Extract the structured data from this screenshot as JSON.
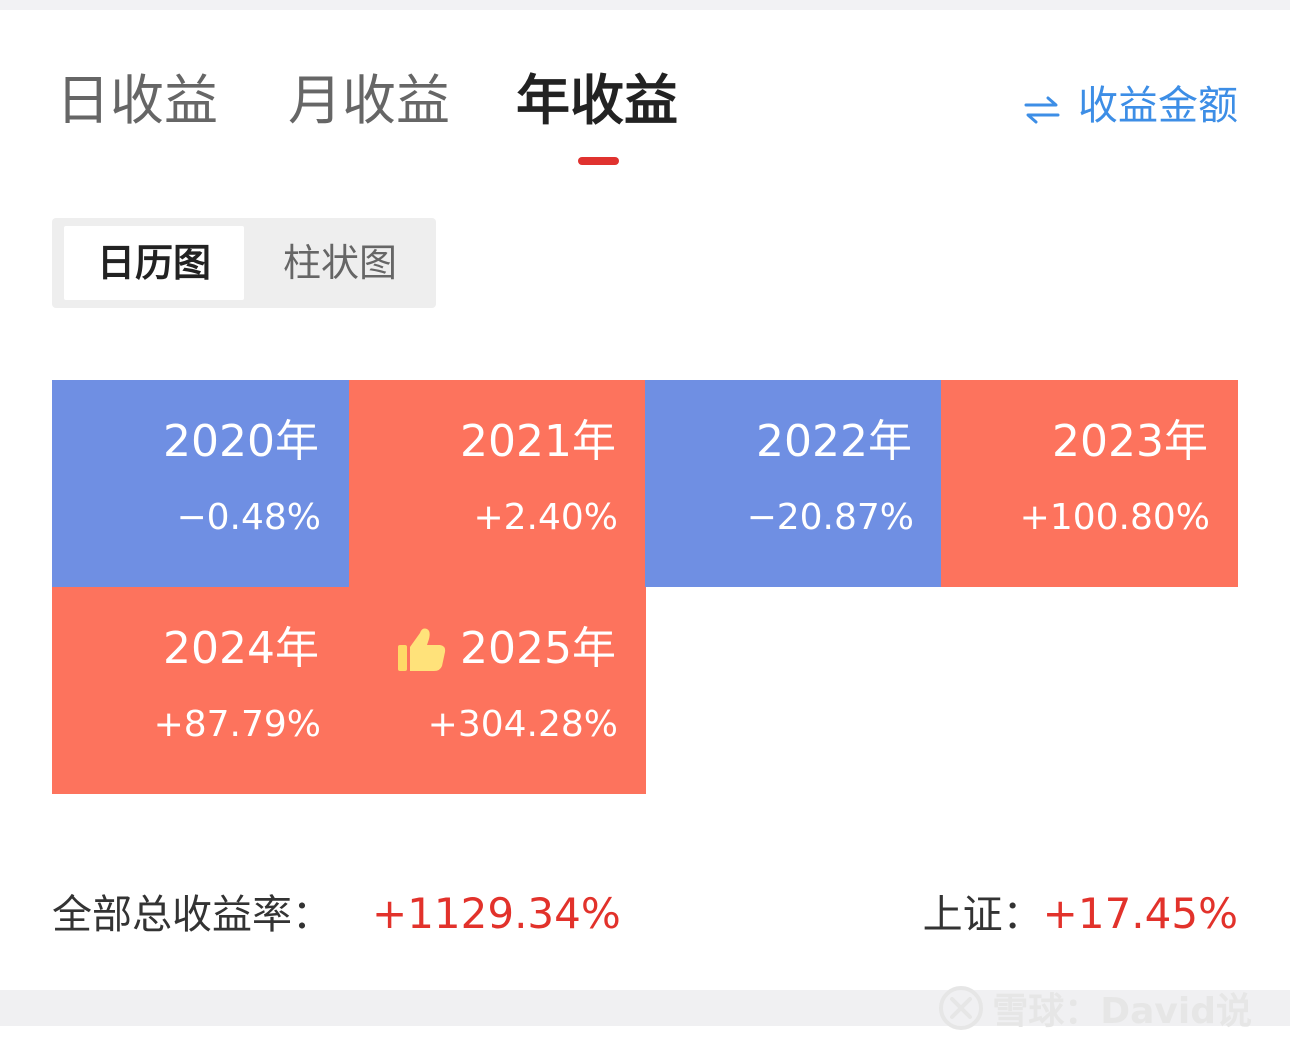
{
  "tabs": [
    {
      "label": "日收益"
    },
    {
      "label": "月收益"
    },
    {
      "label": "年收益",
      "active": true
    }
  ],
  "toggle_link": {
    "icon": "swap-arrows-icon",
    "label": "收益金额"
  },
  "view_switch": {
    "options": [
      {
        "label": "日历图",
        "selected": true
      },
      {
        "label": "柱状图"
      }
    ]
  },
  "years": [
    {
      "year": "2020年",
      "rate": "−0.48%"
    },
    {
      "year": "2021年",
      "rate": "+2.40%"
    },
    {
      "year": "2022年",
      "rate": "−20.87%"
    },
    {
      "year": "2023年",
      "rate": "+100.80%"
    },
    {
      "year": "2024年",
      "rate": "+87.79%"
    },
    {
      "year": "2025年",
      "rate": "+304.28%",
      "icon": "thumbs-up-icon"
    }
  ],
  "summary": {
    "total_label": "全部总收益率：",
    "total_value": "+1129.34%",
    "index_label": "上证：",
    "index_value": "+17.45%"
  },
  "colors": {
    "positive": "#fd735d",
    "negative": "#6f8fe3",
    "accent_red": "#e2322b",
    "link_blue": "#3d8ee6"
  },
  "watermark": {
    "text": "雪球：David说"
  }
}
